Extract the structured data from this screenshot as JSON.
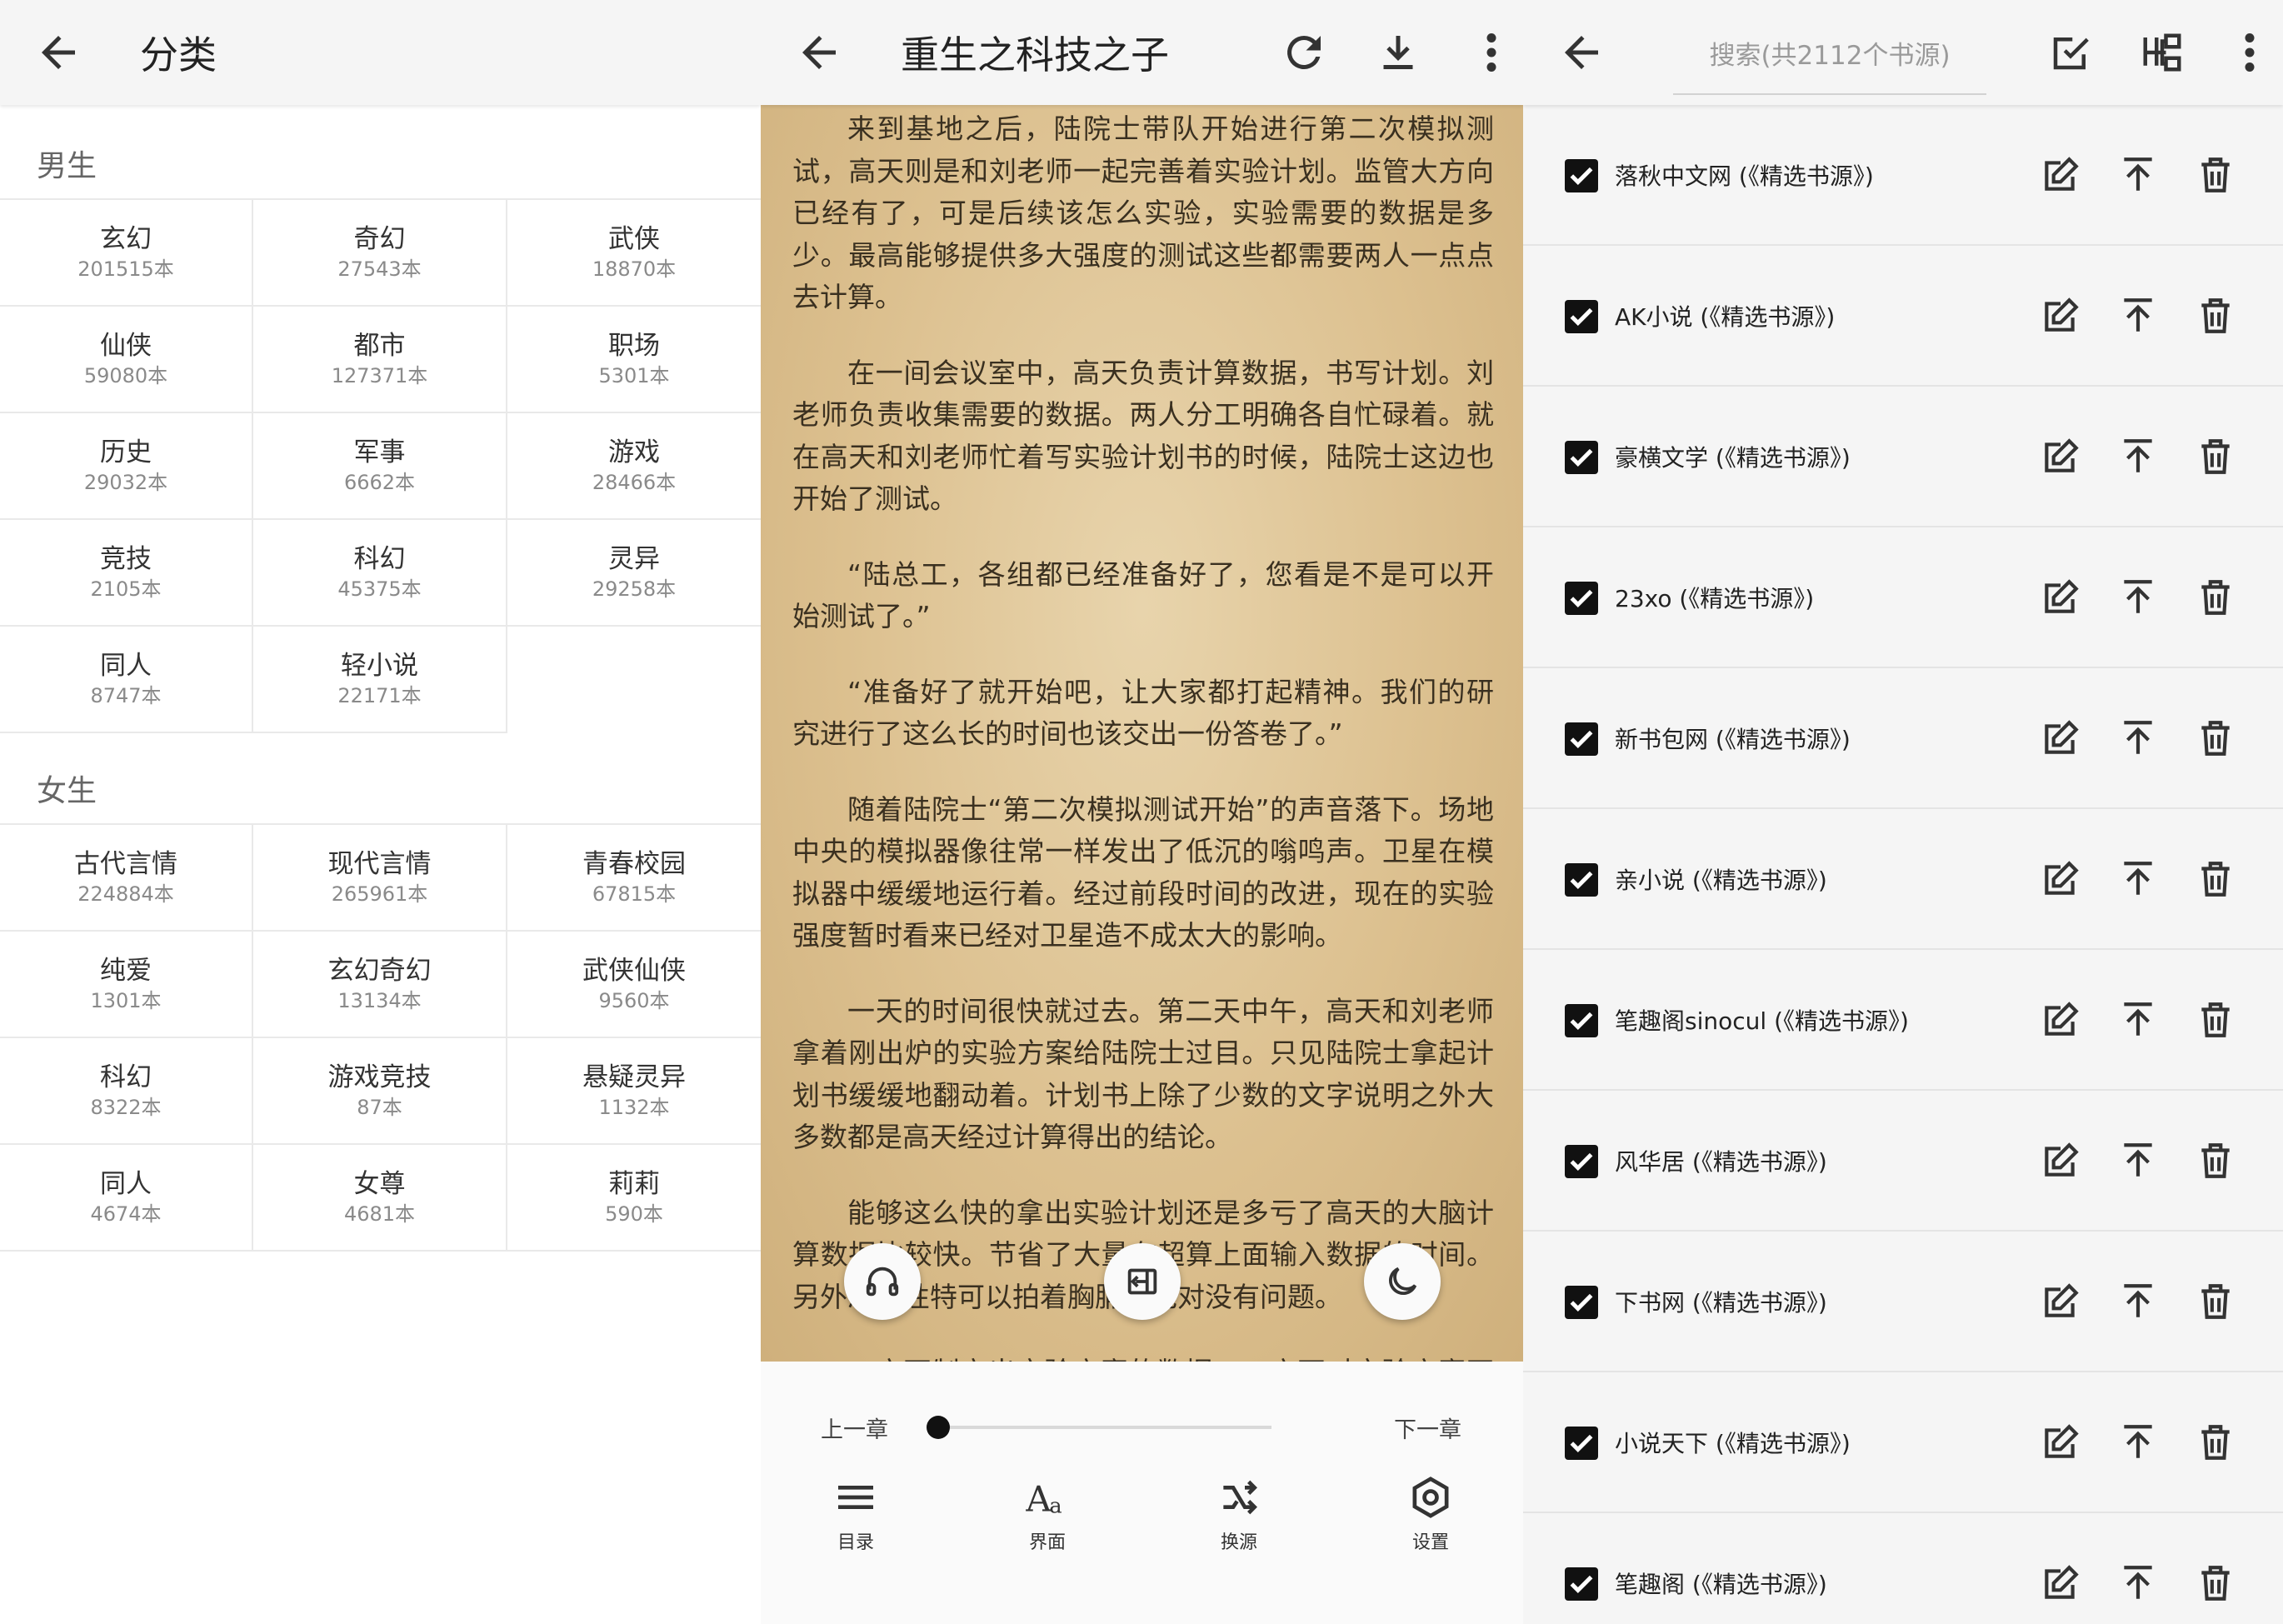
{
  "categories_screen": {
    "title": "分类",
    "sections": [
      {
        "title": "男生",
        "items": [
          {
            "name": "玄幻",
            "count": "201515本"
          },
          {
            "name": "奇幻",
            "count": "27543本"
          },
          {
            "name": "武侠",
            "count": "18870本"
          },
          {
            "name": "仙侠",
            "count": "59080本"
          },
          {
            "name": "都市",
            "count": "127371本"
          },
          {
            "name": "职场",
            "count": "5301本"
          },
          {
            "name": "历史",
            "count": "29032本"
          },
          {
            "name": "军事",
            "count": "6662本"
          },
          {
            "name": "游戏",
            "count": "28466本"
          },
          {
            "name": "竞技",
            "count": "2105本"
          },
          {
            "name": "科幻",
            "count": "45375本"
          },
          {
            "name": "灵异",
            "count": "29258本"
          },
          {
            "name": "同人",
            "count": "8747本"
          },
          {
            "name": "轻小说",
            "count": "22171本"
          }
        ]
      },
      {
        "title": "女生",
        "items": [
          {
            "name": "古代言情",
            "count": "224884本"
          },
          {
            "name": "现代言情",
            "count": "265961本"
          },
          {
            "name": "青春校园",
            "count": "67815本"
          },
          {
            "name": "纯爱",
            "count": "1301本"
          },
          {
            "name": "玄幻奇幻",
            "count": "13134本"
          },
          {
            "name": "武侠仙侠",
            "count": "9560本"
          },
          {
            "name": "科幻",
            "count": "8322本"
          },
          {
            "name": "游戏竞技",
            "count": "87本"
          },
          {
            "name": "悬疑灵异",
            "count": "1132本"
          },
          {
            "name": "同人",
            "count": "4674本"
          },
          {
            "name": "女尊",
            "count": "4681本"
          },
          {
            "name": "莉莉",
            "count": "590本"
          }
        ]
      }
    ]
  },
  "reader_screen": {
    "title": "重生之科技之子",
    "paragraphs": [
      "来到基地之后，陆院士带队开始进行第二次模拟测试，高天则是和刘老师一起完善着实验计划。监管大方向已经有了，可是后续该怎么实验，实验需要的数据是多少。最高能够提供多大强度的测试这些都需要两人一点点去计算。",
      "在一间会议室中，高天负责计算数据，书写计划。刘老师负责收集需要的数据。两人分工明确各自忙碌着。就在高天和刘老师忙着写实验计划书的时候，陆院士这边也开始了测试。",
      "“陆总工，各组都已经准备好了，您看是不是可以开始测试了。”",
      "“准备好了就开始吧，让大家都打起精神。我们的研究进行了这么长的时间也该交出一份答卷了。”",
      "随着陆院士“第二次模拟测试开始”的声音落下。场地中央的模拟器像往常一样发出了低沉的嗡鸣声。卫星在模拟器中缓缓地运行着。经过前段时间的改进，现在的实验强度暂时看来已经对卫星造不成太大的影响。",
      "一天的时间很快就过去。第二天中午，高天和刘老师拿着刚出炉的实验方案给陆院士过目。只见陆院士拿起计划书缓缓地翻动着。计划书上除了少数的文字说明之外大多数都是高天经过计算得出的结论。",
      "能够这么快的拿出实验计划还是多亏了高天的大脑计算数据比较快。节省了大量在超算上面输入数据的时间。另外准确性特可以拍着胸脯说绝对没有问题。",
      "一方面制定出实验方案的数据，一方面对实验方案不断地进行修正，两人用了整整一天的时间。"
    ],
    "prev_chapter": "上一章",
    "next_chapter": "下一章",
    "progress": 0.0,
    "menu": [
      {
        "label": "目录",
        "icon": "toc-icon"
      },
      {
        "label": "界面",
        "icon": "font-icon"
      },
      {
        "label": "换源",
        "icon": "swap-source-icon"
      },
      {
        "label": "设置",
        "icon": "settings-icon"
      }
    ],
    "fabs": [
      "headphones-icon",
      "auto-page-icon",
      "night-mode-icon"
    ]
  },
  "sources_screen": {
    "search_placeholder": "搜索(共2112个书源)",
    "sources": [
      {
        "name": "落秋中文网 (《精选书源》)",
        "checked": true
      },
      {
        "name": "AK小说 (《精选书源》)",
        "checked": true
      },
      {
        "name": "豪横文学 (《精选书源》)",
        "checked": true
      },
      {
        "name": "23xo (《精选书源》)",
        "checked": true
      },
      {
        "name": "新书包网 (《精选书源》)",
        "checked": true
      },
      {
        "name": "亲小说 (《精选书源》)",
        "checked": true
      },
      {
        "name": "笔趣阁sinocul (《精选书源》)",
        "checked": true
      },
      {
        "name": "风华居 (《精选书源》)",
        "checked": true
      },
      {
        "name": "下书网 (《精选书源》)",
        "checked": true
      },
      {
        "name": "小说天下 (《精选书源》)",
        "checked": true
      },
      {
        "name": "笔趣阁 (《精选书源》)",
        "checked": true
      }
    ]
  },
  "colors": {
    "appbar_bg": "#f5f5f5",
    "paper": "#dcc08f",
    "text_dark": "#333333",
    "muted": "#8a8a8a",
    "checkbox": "#111111"
  }
}
